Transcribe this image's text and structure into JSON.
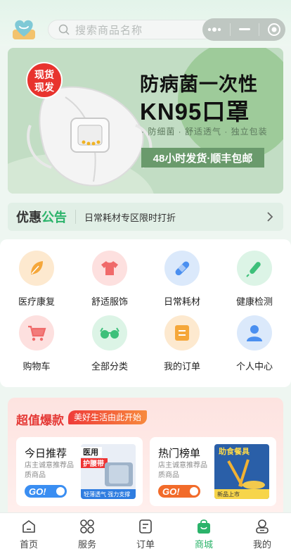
{
  "header": {
    "search_placeholder": "搜索商品名称"
  },
  "banner": {
    "stamp": "现货\n现发",
    "stamp_line1": "现货",
    "stamp_line2": "现发",
    "title": "防病菌一次性",
    "product": "KN95口罩",
    "features": "· 防细菌 · 舒适透气 · 独立包装",
    "shipping": "48小时发货·顺丰包邮"
  },
  "notice": {
    "label_part1": "优惠",
    "label_part2": "公告",
    "text": "日常耗材专区限时打折"
  },
  "categories": [
    {
      "label": "医疗康复",
      "icon": "leaf-icon",
      "bg": "#fde9cf",
      "color": "#f5a73a"
    },
    {
      "label": "舒适服饰",
      "icon": "shirt-icon",
      "bg": "#fde0df",
      "color": "#f06a6a"
    },
    {
      "label": "日常耗材",
      "icon": "bandage-icon",
      "bg": "#dbe9fb",
      "color": "#4a8ff0"
    },
    {
      "label": "健康检测",
      "icon": "thermometer-icon",
      "bg": "#dcf4e6",
      "color": "#3dc07a"
    },
    {
      "label": "购物车",
      "icon": "cart-icon",
      "bg": "#fde0df",
      "color": "#f06a6a"
    },
    {
      "label": "全部分类",
      "icon": "glasses-icon",
      "bg": "#dcf4e6",
      "color": "#3dc07a"
    },
    {
      "label": "我的订单",
      "icon": "order-icon",
      "bg": "#fde9cf",
      "color": "#f5a73a"
    },
    {
      "label": "个人中心",
      "icon": "user-icon",
      "bg": "#dbe9fb",
      "color": "#4a8ff0"
    }
  ],
  "deals": {
    "title": "超值爆款",
    "tag": "美好生活由此开始",
    "cards": [
      {
        "title": "今日推荐",
        "sub": "店主诚意推荐品质商品",
        "go": "GO!",
        "go_color": "#3a8ef2",
        "img_label1": "医用",
        "img_label2": "护腰带",
        "img_caption": "轻薄透气 强力支撑"
      },
      {
        "title": "热门榜单",
        "sub": "店主诚意推荐品质商品",
        "go": "GO!",
        "go_color": "#f26b2a",
        "img_label1": "助食餐具",
        "img_caption": "新品上市"
      }
    ]
  },
  "tabbar": [
    {
      "label": "首页",
      "icon": "home-icon",
      "active": false
    },
    {
      "label": "服务",
      "icon": "grid-icon",
      "active": false
    },
    {
      "label": "订单",
      "icon": "document-icon",
      "active": false
    },
    {
      "label": "商城",
      "icon": "shopping-bag-icon",
      "active": true
    },
    {
      "label": "我的",
      "icon": "profile-icon",
      "active": false
    }
  ],
  "colors": {
    "accent": "#2bb36a",
    "deal_red": "#e53a37"
  }
}
